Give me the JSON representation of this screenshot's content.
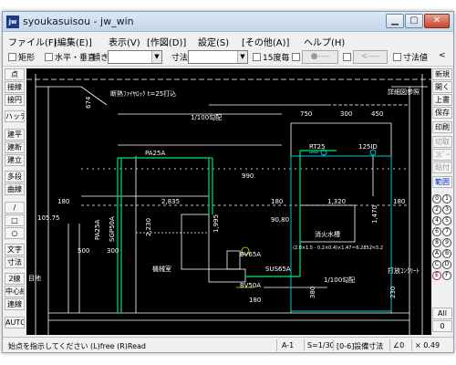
{
  "window": {
    "title": "syoukasuisou - jw_win"
  },
  "menu": [
    "ファイル(F)",
    "[編集(E)]",
    "表示(V)",
    "[作図(D)]",
    "設定(S)",
    "[その他(A)]",
    "ヘルプ(H)"
  ],
  "toolbar": {
    "rect_label": "矩形",
    "hv_label": "水平・垂直",
    "tilt_label": "傾き",
    "dim_label": "寸法",
    "deg15_label": "15度毎",
    "btn1": "●----",
    "btn2": "<----",
    "dimval_label": "寸法値",
    "angle_mark": "<"
  },
  "left_tools": [
    "点",
    "接線",
    "接円",
    "ハッチ",
    "建平",
    "建断",
    "建立",
    "多段",
    "曲線",
    "/",
    "□",
    "○",
    "文字",
    "寸法",
    "2線",
    "中心線",
    "連線",
    "AUTO"
  ],
  "right_tools": {
    "buttons": [
      "新規",
      "開く",
      "上書",
      "保存",
      "印刷",
      "切取",
      "ｺﾋﾟｰ",
      "貼付",
      "範囲"
    ],
    "bottom": [
      "All",
      "0"
    ],
    "layers": [
      "0",
      "1",
      "2",
      "3",
      "4",
      "5",
      "6",
      "7",
      "8",
      "9",
      "A",
      "B",
      "C",
      "D",
      "E",
      "F"
    ]
  },
  "status": {
    "hint": "始点を指示してください (L)free (R)Read",
    "paper": "A-1",
    "scale": "S=1/30",
    "layer": "[0-6]設備寸法",
    "angle": "∠0",
    "zoom": "× 0.49"
  },
  "drawing": {
    "labels": {
      "pipe_note": "断熱ﾌｧｲﾔﾛｯｸ t=25打込",
      "slope_top": "1/100勾配",
      "dim_674": "674",
      "dim_750": "750",
      "dim_300": "300",
      "dim_450": "450",
      "pa25": "PA25A",
      "rt25": "RT25",
      "pipe125": "125ID",
      "dim_990": "990",
      "dim_180": "180",
      "dim_2835": "2,835",
      "dim_180b": "180",
      "dim_1320": "1,320",
      "dim_180c": "180",
      "dim_10575": "105.75",
      "pa25v": "PA25A",
      "sgp": "SGP50A",
      "dim_2230": "2,230",
      "dim_1995": "1,995",
      "dim_9080": "90,80",
      "dim_1470": "1,470",
      "dim_500": "500",
      "dim_300b": "300",
      "pump_room": "機械室",
      "tank": "消火水槽",
      "tank_formula": "(2.8×1.5 - 0.2×0.4)×1.47＝6.2852≒5.2",
      "bv65": "BV65A",
      "sus": "SUS65A",
      "bv50": "BV50A",
      "slope_bot": "1/100勾配",
      "rh": "目地",
      "pipe_desc": "打放ｺﾝｸﾘｰﾄ",
      "detail": "詳細図参照",
      "hole": "380",
      "dim_180d": "180",
      "dim_230": "230"
    }
  },
  "colors": {
    "canvas_bg": "#000000",
    "line_white": "#ffffff",
    "line_green": "#00c060",
    "line_cyan": "#00c8c8",
    "line_yellow": "#e0e000",
    "status_red": "#c01818"
  }
}
